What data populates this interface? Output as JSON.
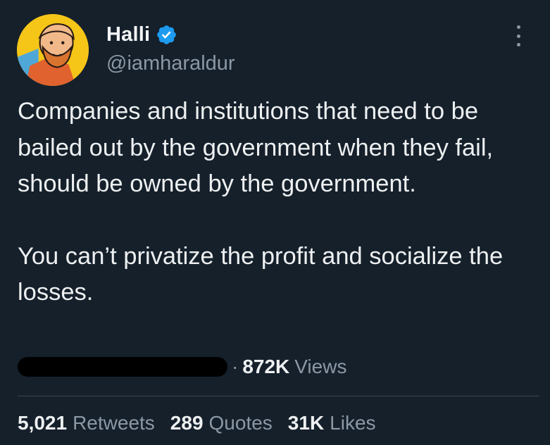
{
  "author": {
    "display_name": "Halli",
    "handle": "@iamharaldur",
    "verified_color": "#1d9bf0"
  },
  "tweet": {
    "paragraphs": [
      "Companies and institutions that need to be bailed out by the government when they fail, should be owned by the government.",
      "You can’t privatize the profit and socialize the losses."
    ]
  },
  "meta": {
    "separator": "·",
    "views_count": "872K",
    "views_label": "Views"
  },
  "stats": {
    "retweets_count": "5,021",
    "retweets_label": "Retweets",
    "quotes_count": "289",
    "quotes_label": "Quotes",
    "likes_count": "31K",
    "likes_label": "Likes"
  },
  "icons": {
    "more": "more-options-icon",
    "verified": "verified-badge-icon"
  },
  "colors": {
    "background": "#15202b",
    "text_primary": "#e7e9ea",
    "text_secondary": "#8b98a5",
    "divider": "#38444d"
  }
}
